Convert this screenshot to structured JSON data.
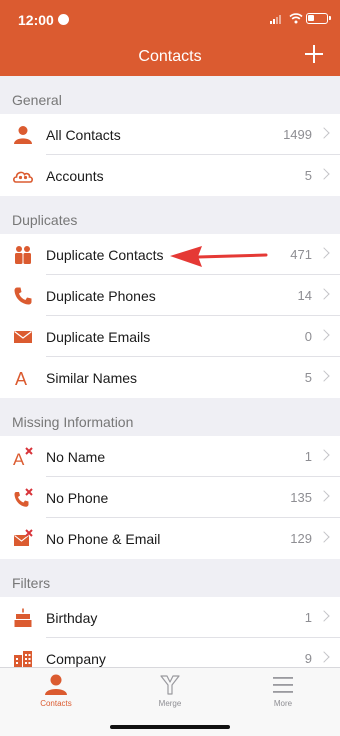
{
  "status": {
    "time": "12:00"
  },
  "nav": {
    "title": "Contacts"
  },
  "colors": {
    "accent": "#db5b30",
    "chevron": "#c4c4c8",
    "arrow": "#e53935"
  },
  "sections": [
    {
      "title": "General",
      "rows": [
        {
          "label": "All Contacts",
          "value": "1499",
          "icon": "person-icon"
        },
        {
          "label": "Accounts",
          "value": "5",
          "icon": "cloud-people-icon"
        }
      ]
    },
    {
      "title": "Duplicates",
      "rows": [
        {
          "label": "Duplicate Contacts",
          "value": "471",
          "icon": "people-icon"
        },
        {
          "label": "Duplicate Phones",
          "value": "14",
          "icon": "phone-icon"
        },
        {
          "label": "Duplicate Emails",
          "value": "0",
          "icon": "envelope-icon"
        },
        {
          "label": "Similar Names",
          "value": "5",
          "icon": "letter-a-icon"
        }
      ]
    },
    {
      "title": "Missing Information",
      "rows": [
        {
          "label": "No Name",
          "value": "1",
          "icon": "letter-a-x-icon"
        },
        {
          "label": "No Phone",
          "value": "135",
          "icon": "phone-x-icon"
        },
        {
          "label": "No Phone & Email",
          "value": "129",
          "icon": "envelope-x-icon"
        }
      ]
    },
    {
      "title": "Filters",
      "rows": [
        {
          "label": "Birthday",
          "value": "1",
          "icon": "cake-icon"
        },
        {
          "label": "Company",
          "value": "9",
          "icon": "building-icon"
        }
      ]
    }
  ],
  "tabs": [
    {
      "label": "Contacts",
      "icon": "person-icon",
      "active": true
    },
    {
      "label": "Merge",
      "icon": "merge-icon",
      "active": false
    },
    {
      "label": "More",
      "icon": "menu-icon",
      "active": false
    }
  ]
}
